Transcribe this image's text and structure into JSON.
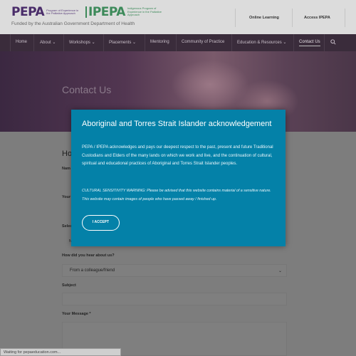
{
  "header": {
    "pepa_logo": "PEPA",
    "pepa_sub": "Program of Experience in the Palliative Approach",
    "ipepa_logo": "IPEPA",
    "ipepa_sub": "Indigenous Program of Experience in the Palliative Approach",
    "funded": "Funded by the Australian Government Department of Health",
    "online_learning": "Online Learning",
    "access_ipepa": "Access IPEPA"
  },
  "nav": {
    "items": [
      "Home",
      "About",
      "Workshops",
      "Placements",
      "Mentoring",
      "Community of Practice",
      "Education & Resources",
      "Contact Us"
    ]
  },
  "hero": {
    "title": "Contact Us"
  },
  "form": {
    "heading_partial": "Ho",
    "name_partial": "Nam",
    "your_partial": "Your",
    "select_partial": "Selec",
    "select_value_partial": "N",
    "hear_label": "How did you hear about us?",
    "hear_value": "From a colleague/friend",
    "subject_label": "Subject",
    "message_label": "Your Message",
    "required_mark": "*"
  },
  "modal": {
    "title": "Aboriginal and Torres Strait Islander acknowledgement",
    "body": "PEPA / IPEPA acknowledges and pays our deepest respect to the past, present and future Traditional Custodians and Elders of the many lands on which we work and live, and the continuation of cultural, spiritual and educational practices of Aboriginal and Torres Strait Islander peoples.",
    "warning": "CULTURAL SENSITIVITY WARNING: Please be advised that this website contains material of a sensitive nature. This website may contain images of people who have passed away / finished up.",
    "accept_label": "I ACCEPT"
  },
  "status": {
    "text": "Waiting for pepaeducation.com..."
  },
  "colors": {
    "modal": "#0481a8",
    "nav": "#3a2c3b",
    "header": "#dcdcdc",
    "pepa_purple": "#4a2d6a",
    "ipepa_green": "#3d8a5a"
  }
}
